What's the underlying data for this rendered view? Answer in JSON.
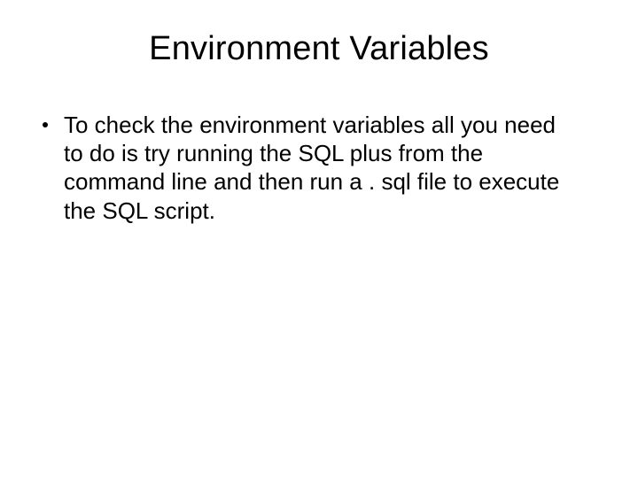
{
  "title": "Environment Variables",
  "bullets": [
    {
      "text": "To check the environment variables all you need to do is try running the SQL plus from the command line and then run a . sql file to execute the SQL script."
    }
  ]
}
